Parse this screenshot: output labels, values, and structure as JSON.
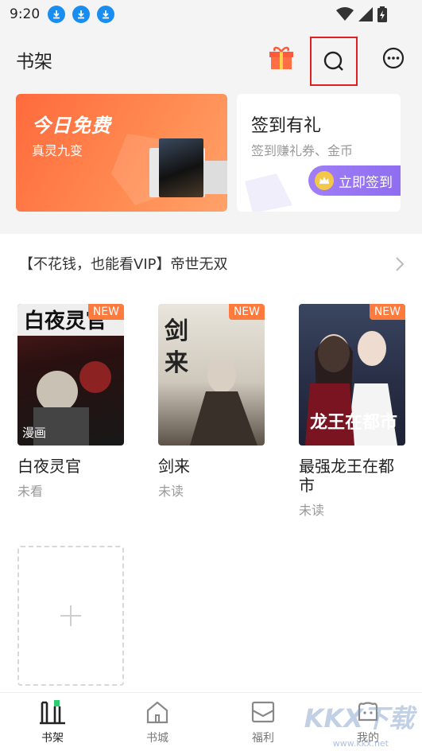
{
  "status_bar": {
    "time": "9:20"
  },
  "header": {
    "title": "书架"
  },
  "promo": {
    "free": {
      "title": "今日免费",
      "book": "真灵九变"
    },
    "sign": {
      "title": "签到有礼",
      "subtitle": "签到赚礼券、金币",
      "button": "立即签到"
    }
  },
  "banner": {
    "text": "【不花钱，也能看VIP】帝世无双"
  },
  "books": [
    {
      "title": "白夜灵官",
      "status": "未看",
      "badge": "NEW",
      "tag": "漫画"
    },
    {
      "title": "剑来",
      "status": "未读",
      "badge": "NEW",
      "tag": ""
    },
    {
      "title": "最强龙王在都市",
      "status": "未读",
      "badge": "NEW",
      "tag": ""
    }
  ],
  "nav": [
    {
      "label": "书架",
      "active": true
    },
    {
      "label": "书城",
      "active": false
    },
    {
      "label": "福利",
      "active": false
    },
    {
      "label": "我的",
      "active": false
    }
  ],
  "watermark": {
    "text": "KKX下载",
    "url": "www.kkx.net"
  },
  "colors": {
    "accent_orange": "#ff6a3d",
    "sign_purple": "#8d6cf0",
    "status_blue": "#1a8ef0",
    "highlight_red": "#e02020"
  }
}
